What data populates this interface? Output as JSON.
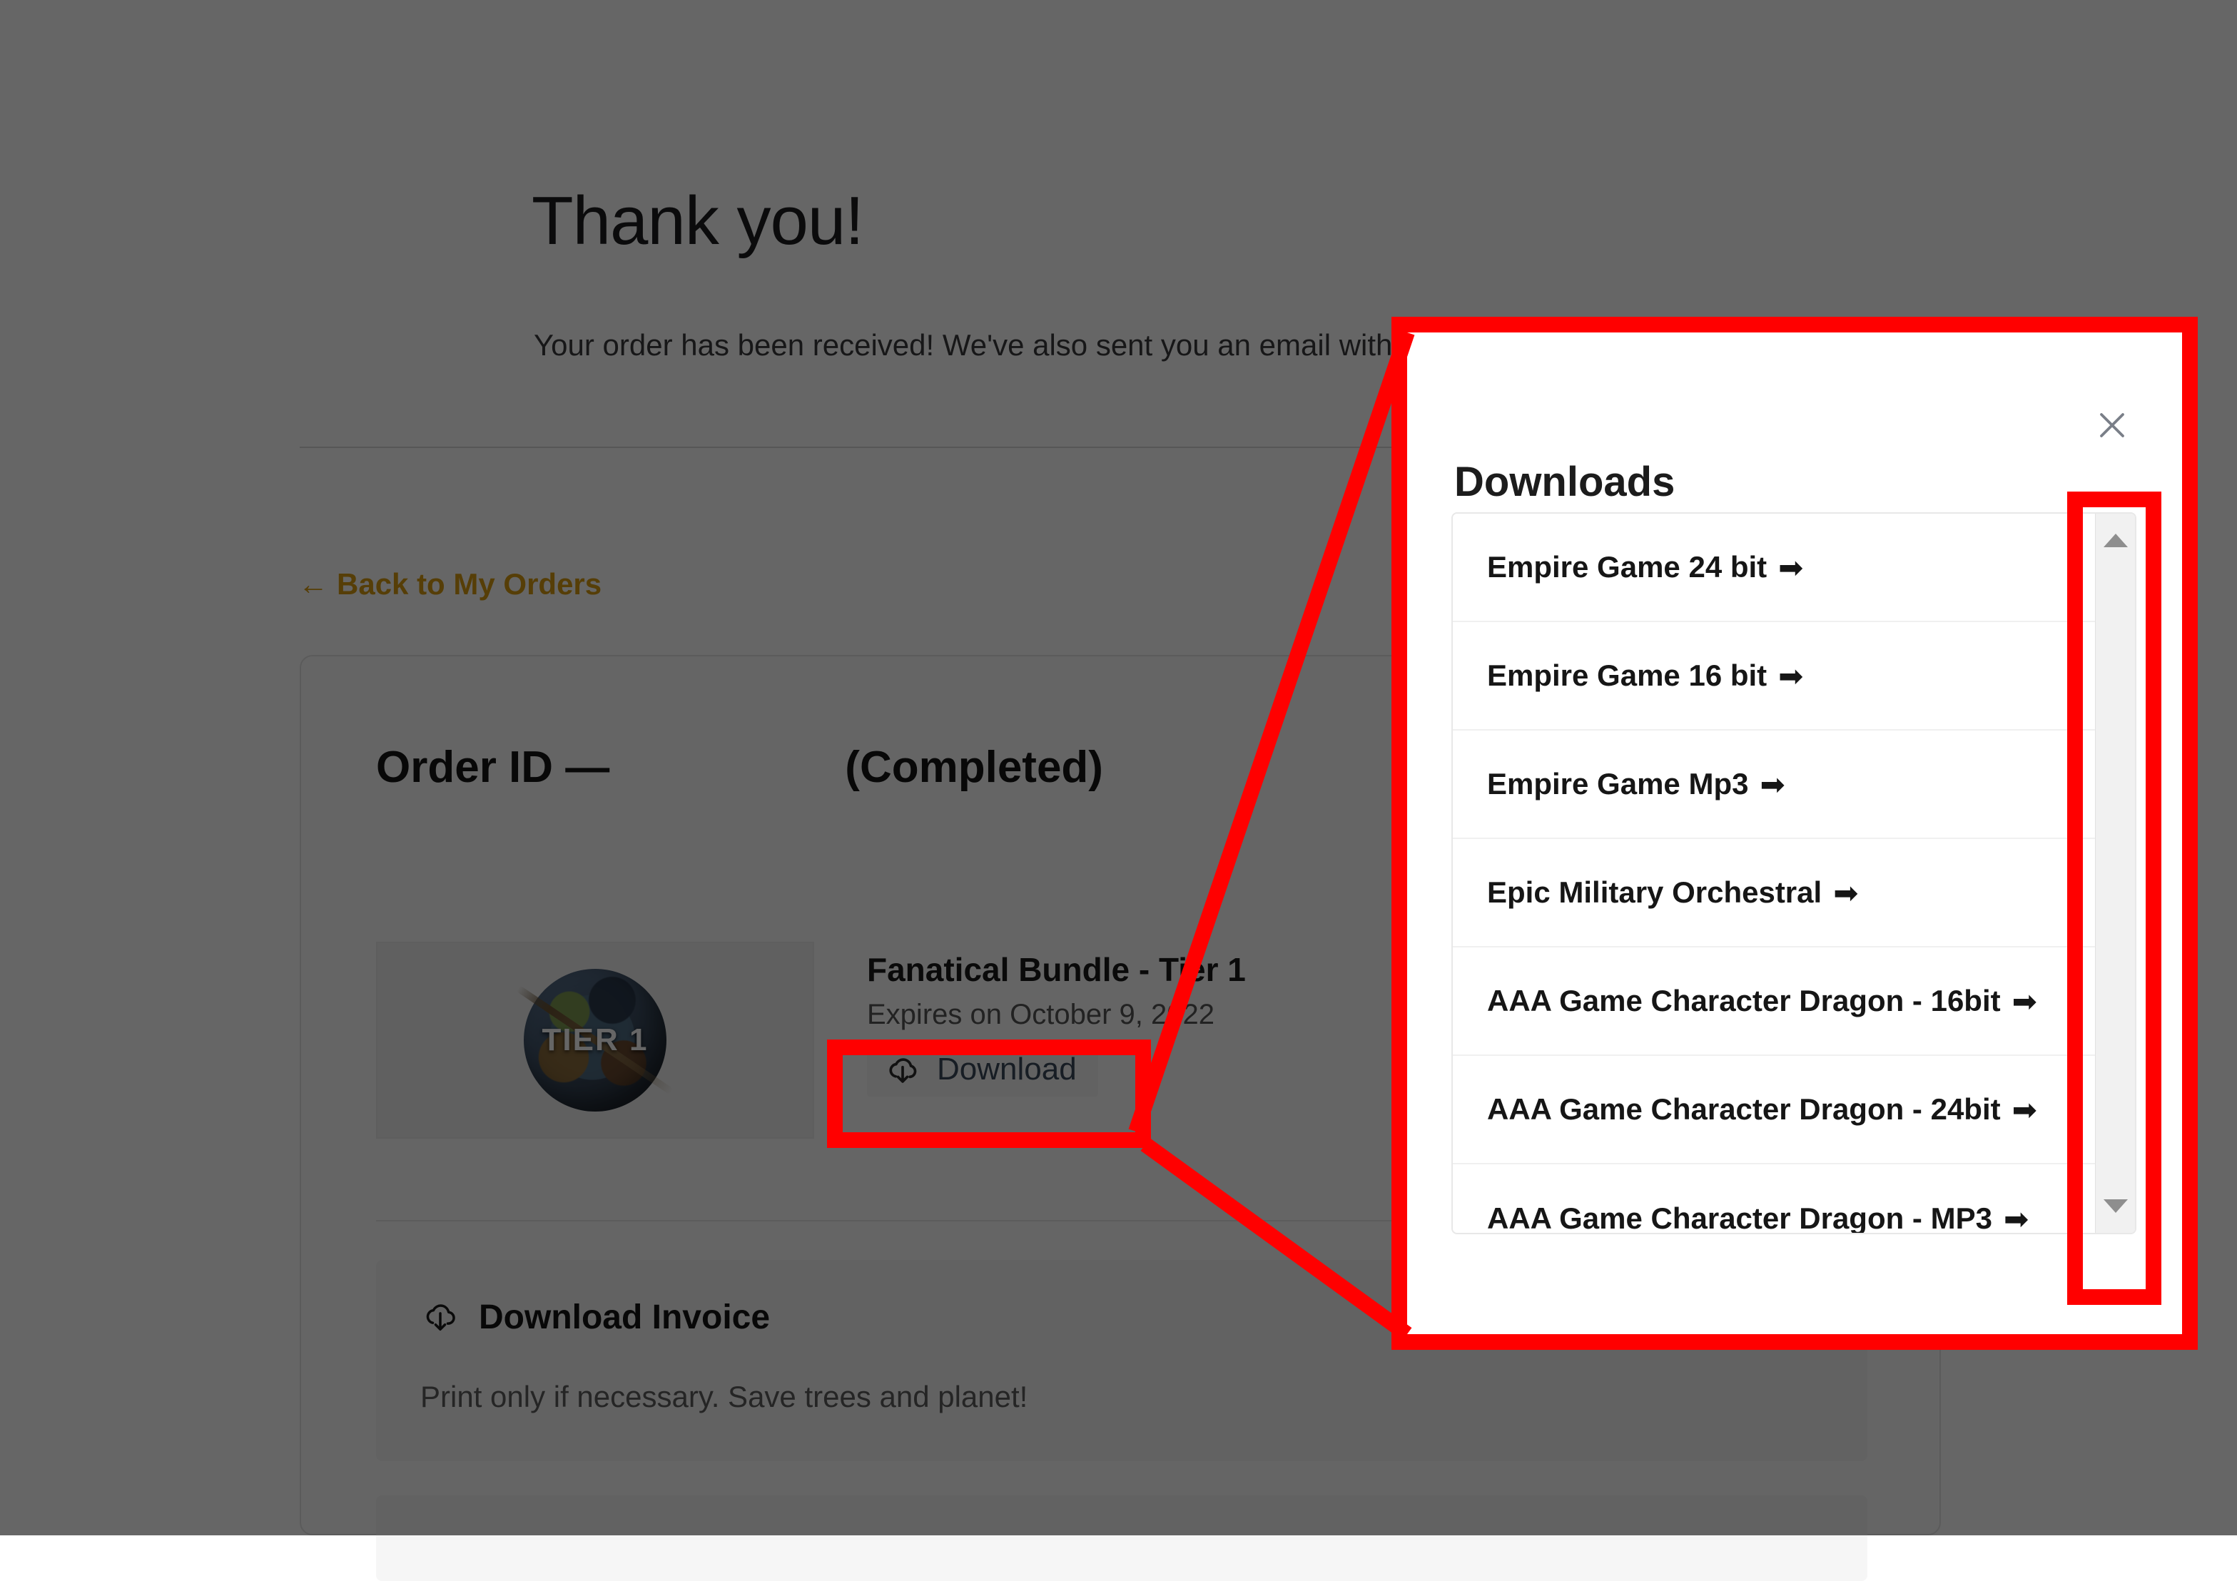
{
  "page": {
    "title": "Thank you!",
    "subtitle": "Your order has been received! We've also sent you an email with the order details.",
    "back_link_arrow": "←",
    "back_link_label": "Back to My Orders",
    "divider": ""
  },
  "order": {
    "id_label": "Order ID —",
    "status": "(Completed)",
    "product": {
      "thumbnail_text": "TIER 1",
      "name": "Fanatical Bundle - Tier 1",
      "expiry": "Expires on October 9, 2022",
      "download_button_label": "Download",
      "download_icon": "cloud-download-icon"
    },
    "invoice": {
      "icon": "cloud-download-icon",
      "title": "Download Invoice",
      "note": "Print only if necessary. Save trees and planet!"
    }
  },
  "modal": {
    "title": "Downloads",
    "close_icon": "close-icon",
    "close_label": "×",
    "items": [
      {
        "label": "Empire Game 24 bit",
        "arrow": "➡"
      },
      {
        "label": "Empire Game 16 bit",
        "arrow": "➡"
      },
      {
        "label": "Empire Game Mp3",
        "arrow": "➡"
      },
      {
        "label": "Epic Military Orchestral",
        "arrow": "➡"
      },
      {
        "label": "AAA Game Character Dragon - 16bit",
        "arrow": "➡"
      },
      {
        "label": "AAA Game Character Dragon - 24bit",
        "arrow": "➡"
      },
      {
        "label": "AAA Game Character Dragon - MP3",
        "arrow": "➡"
      }
    ],
    "scrollbar": {
      "up_icon": "scroll-up-arrow-icon",
      "down_icon": "scroll-down-arrow-icon"
    }
  },
  "annotation": {
    "color": "#FF0000",
    "highlight_download_button": true,
    "highlight_modal": true,
    "highlight_scrollbar": true
  }
}
